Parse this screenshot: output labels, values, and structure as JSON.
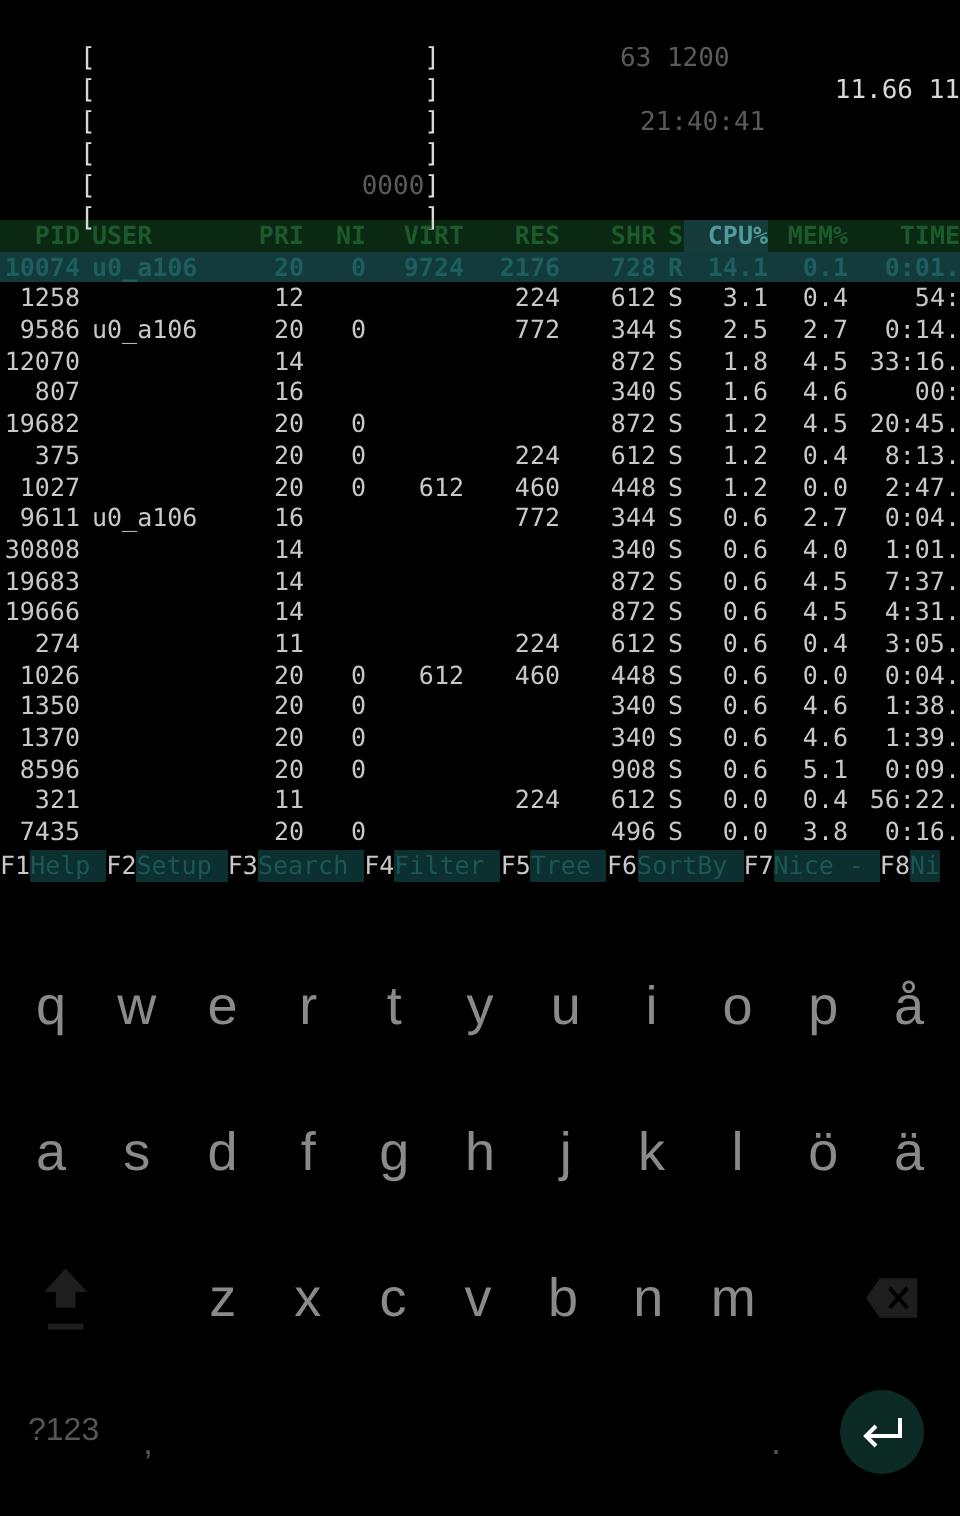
{
  "header": {
    "meters": [
      {
        "open": "[",
        "close": "]"
      },
      {
        "open": "[",
        "close": "]"
      },
      {
        "open": "[",
        "close": "]"
      },
      {
        "open": "[",
        "close": "]"
      },
      {
        "open": "[",
        "close": "]",
        "tail": "0000"
      },
      {
        "open": "[",
        "close": "]"
      }
    ],
    "info": [
      {
        "text": "63  1200",
        "kind": "dim"
      },
      {
        "text": "11.66 11",
        "kind": "bright"
      },
      {
        "text": "21:40:41",
        "kind": "dim"
      }
    ]
  },
  "table": {
    "columns": [
      {
        "label": "PID",
        "selected": false
      },
      {
        "label": "USER",
        "selected": false
      },
      {
        "label": "PRI",
        "selected": false
      },
      {
        "label": "NI",
        "selected": false
      },
      {
        "label": "VIRT",
        "selected": false
      },
      {
        "label": "RES",
        "selected": false
      },
      {
        "label": "SHR",
        "selected": false
      },
      {
        "label": "S",
        "selected": false
      },
      {
        "label": "CPU%",
        "selected": true
      },
      {
        "label": "MEM%",
        "selected": false
      },
      {
        "label": "TIME",
        "selected": false
      }
    ],
    "rows": [
      {
        "selected": true,
        "pid": "10074",
        "user": "u0_a106",
        "pri": "20",
        "ni": "0",
        "virt": "9724",
        "res": "2176",
        "shr": "728",
        "s": "R",
        "cpu": "14.1",
        "mem": "0.1",
        "time": "0:01."
      },
      {
        "selected": false,
        "pid": "1258",
        "pri": "12",
        "res": "224",
        "shr": "612",
        "s": "S",
        "cpu": "3.1",
        "mem": "0.4",
        "time": "54:"
      },
      {
        "selected": false,
        "pid": "9586",
        "user": "u0_a106",
        "pri": "20",
        "ni": "0",
        "res": "772",
        "shr": "344",
        "s": "S",
        "cpu": "2.5",
        "mem": "2.7",
        "time": "0:14."
      },
      {
        "selected": false,
        "pid": "12070",
        "pri": "14",
        "shr": "872",
        "s": "S",
        "cpu": "1.8",
        "mem": "4.5",
        "time": "33:16."
      },
      {
        "selected": false,
        "pid": "807",
        "pri": "16",
        "shr": "340",
        "s": "S",
        "cpu": "1.6",
        "mem": "4.6",
        "time": "00:"
      },
      {
        "selected": false,
        "pid": "19682",
        "pri": "20",
        "ni": "0",
        "shr": "872",
        "s": "S",
        "cpu": "1.2",
        "mem": "4.5",
        "time": "20:45."
      },
      {
        "selected": false,
        "pid": "375",
        "pri": "20",
        "ni": "0",
        "res": "224",
        "shr": "612",
        "s": "S",
        "cpu": "1.2",
        "mem": "0.4",
        "time": "8:13."
      },
      {
        "selected": false,
        "pid": "1027",
        "pri": "20",
        "ni": "0",
        "virt": "612",
        "res": "460",
        "shr": "448",
        "s": "S",
        "cpu": "1.2",
        "mem": "0.0",
        "time": "2:47."
      },
      {
        "selected": false,
        "pid": "9611",
        "user": "u0_a106",
        "pri": "16",
        "res": "772",
        "shr": "344",
        "s": "S",
        "cpu": "0.6",
        "mem": "2.7",
        "time": "0:04."
      },
      {
        "selected": false,
        "pid": "30808",
        "pri": "14",
        "shr": "340",
        "s": "S",
        "cpu": "0.6",
        "mem": "4.0",
        "time": "1:01."
      },
      {
        "selected": false,
        "pid": "19683",
        "pri": "14",
        "shr": "872",
        "s": "S",
        "cpu": "0.6",
        "mem": "4.5",
        "time": "7:37."
      },
      {
        "selected": false,
        "pid": "19666",
        "pri": "14",
        "shr": "872",
        "s": "S",
        "cpu": "0.6",
        "mem": "4.5",
        "time": "4:31."
      },
      {
        "selected": false,
        "pid": "274",
        "pri": "11",
        "res": "224",
        "shr": "612",
        "s": "S",
        "cpu": "0.6",
        "mem": "0.4",
        "time": "3:05."
      },
      {
        "selected": false,
        "pid": "1026",
        "pri": "20",
        "ni": "0",
        "virt": "612",
        "res": "460",
        "shr": "448",
        "s": "S",
        "cpu": "0.6",
        "mem": "0.0",
        "time": "0:04."
      },
      {
        "selected": false,
        "pid": "1350",
        "pri": "20",
        "ni": "0",
        "shr": "340",
        "s": "S",
        "cpu": "0.6",
        "mem": "4.6",
        "time": "1:38."
      },
      {
        "selected": false,
        "pid": "1370",
        "pri": "20",
        "ni": "0",
        "shr": "340",
        "s": "S",
        "cpu": "0.6",
        "mem": "4.6",
        "time": "1:39."
      },
      {
        "selected": false,
        "pid": "8596",
        "pri": "20",
        "ni": "0",
        "shr": "908",
        "s": "S",
        "cpu": "0.6",
        "mem": "5.1",
        "time": "0:09."
      },
      {
        "selected": false,
        "pid": "321",
        "pri": "11",
        "res": "224",
        "shr": "612",
        "s": "S",
        "cpu": "0.0",
        "mem": "0.4",
        "time": "56:22."
      },
      {
        "selected": false,
        "pid": "7435",
        "pri": "20",
        "ni": "0",
        "shr": "496",
        "s": "S",
        "cpu": "0.0",
        "mem": "3.8",
        "time": "0:16."
      }
    ]
  },
  "function_keys": [
    {
      "key": "F1",
      "label": "Help"
    },
    {
      "key": "F2",
      "label": "Setup"
    },
    {
      "key": "F3",
      "label": "Search"
    },
    {
      "key": "F4",
      "label": "Filter"
    },
    {
      "key": "F5",
      "label": "Tree"
    },
    {
      "key": "F6",
      "label": "SortBy"
    },
    {
      "key": "F7",
      "label": "Nice -"
    },
    {
      "key": "F8",
      "label": "Ni"
    }
  ],
  "keyboard": {
    "top_row": [
      "q",
      "w",
      "e",
      "r",
      "t",
      "y",
      "u",
      "i",
      "o",
      "p",
      "å"
    ],
    "middle_row": [
      "a",
      "s",
      "d",
      "f",
      "g",
      "h",
      "j",
      "k",
      "l",
      "ö",
      "ä"
    ],
    "bottom_row": [
      "z",
      "x",
      "c",
      "v",
      "b",
      "n",
      "m"
    ],
    "symbols_key": "?123",
    "comma": ",",
    "period": "."
  }
}
